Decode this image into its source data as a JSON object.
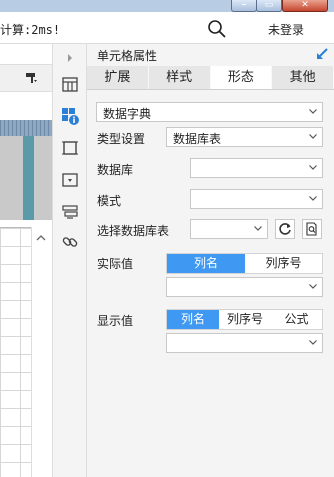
{
  "titlebar": {
    "buttons": {
      "minimize": "–",
      "maximize": "▭",
      "close": "✕"
    }
  },
  "toolbar": {
    "calc_text": "计算:2ms!",
    "login": "未登录"
  },
  "panel": {
    "title": "单元格属性",
    "tabs": [
      {
        "label": "扩展",
        "active": false
      },
      {
        "label": "样式",
        "active": false
      },
      {
        "label": "形态",
        "active": true
      },
      {
        "label": "其他",
        "active": false
      }
    ],
    "dict_select": {
      "value": "数据字典"
    },
    "type_setting": {
      "label": "类型设置",
      "value": "数据库表"
    },
    "database": {
      "label": "数据库",
      "value": ""
    },
    "schema": {
      "label": "模式",
      "value": ""
    },
    "table_select": {
      "label": "选择数据库表",
      "value": ""
    },
    "actual_value": {
      "label": "实际值",
      "options": [
        "列名",
        "列序号"
      ],
      "selected": "列名",
      "select_value": ""
    },
    "display_value": {
      "label": "显示值",
      "options": [
        "列名",
        "列序号",
        "公式"
      ],
      "selected": "列名",
      "select_value": ""
    }
  },
  "colors": {
    "accent": "#3f99f2",
    "panel_bg": "#f4f4f4",
    "tab_bg": "#e6e6e6"
  }
}
